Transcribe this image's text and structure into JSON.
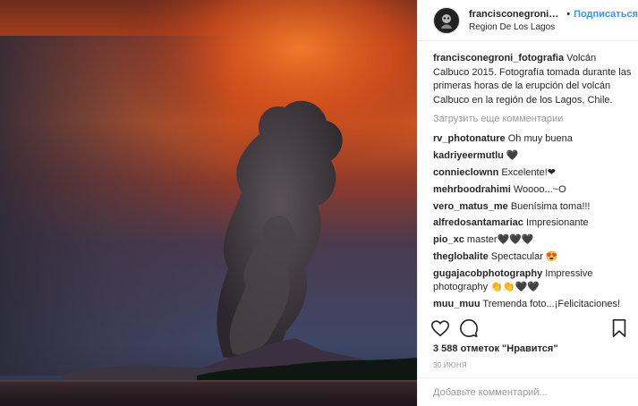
{
  "post": {
    "username": "francisconegroni_fo...",
    "separator": "•",
    "follow_label": "Подписаться",
    "location": "Region De Los Lagos"
  },
  "caption": {
    "username": "francisconegroni_fotografia",
    "text": " Volcán Calbuco 2015. Fotografía tomada durante las primeras horas de la erupción del volcán Calbuco en la región de los Lagos, Chile."
  },
  "load_more_label": "Загрузить еще комментарии",
  "comments": [
    {
      "user": "rv_photonature",
      "text": " Oh muy buena"
    },
    {
      "user": "kadriyeermutlu",
      "text": " 🖤"
    },
    {
      "user": "connieclownn",
      "text": " Excelente!❤"
    },
    {
      "user": "mehrboodrahimi",
      "text": " Woooo...~O"
    },
    {
      "user": "vero_matus_me",
      "text": " Buenísima toma!!!"
    },
    {
      "user": "alfredosantamariac",
      "text": " Impresionante"
    },
    {
      "user": "pio_xc",
      "text": " master🖤🖤🖤"
    },
    {
      "user": "theglobalite",
      "text": " Spectacular 😍"
    },
    {
      "user": "gugajacobphotography",
      "text": " Impressive photography 👏👏🖤🖤"
    },
    {
      "user": "muu_muu",
      "text": " Tremenda foto...¡Felicitaciones!"
    }
  ],
  "likes_label": "3 588 отметок \"Нравится\"",
  "date": "30 июня",
  "comment_input": {
    "placeholder": "Добавьте комментарий..."
  },
  "icons": {
    "like": "heart-icon",
    "comment": "comment-icon",
    "save": "bookmark-icon"
  }
}
